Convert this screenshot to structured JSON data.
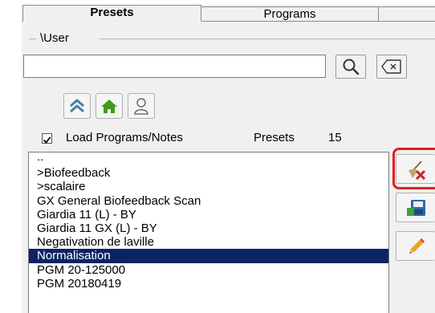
{
  "tabs": [
    {
      "label": "Presets",
      "active": true
    },
    {
      "label": "Programs",
      "active": false
    }
  ],
  "group_label": "\\User",
  "search": {
    "value": "",
    "placeholder": ""
  },
  "icons": {
    "search": "magnifier-icon",
    "clear": "backspace-x-icon",
    "up": "double-chevron-up-icon",
    "home": "home-icon",
    "user": "user-icon",
    "delete": "broom-delete-icon",
    "save": "floppy-save-icon",
    "edit": "pencil-edit-icon"
  },
  "load_programs": {
    "checked": true,
    "label": "Load Programs/Notes"
  },
  "presets_label": "Presets",
  "presets_count": "15",
  "list_items": [
    "..",
    ">Biofeedback",
    ">scalaire",
    "GX General Biofeedback Scan",
    "Giardia 11 (L) - BY",
    "Giardia 11 GX (L) - BY",
    "Negativation de laville",
    "Normalisation",
    "PGM 20-125000",
    "PGM 20180419"
  ],
  "selected_index": 7,
  "colors": {
    "selection": "#0b2462",
    "highlight_border": "#e0201f",
    "home_green": "#3f9a1a",
    "chevron_blue": "#47819f"
  }
}
